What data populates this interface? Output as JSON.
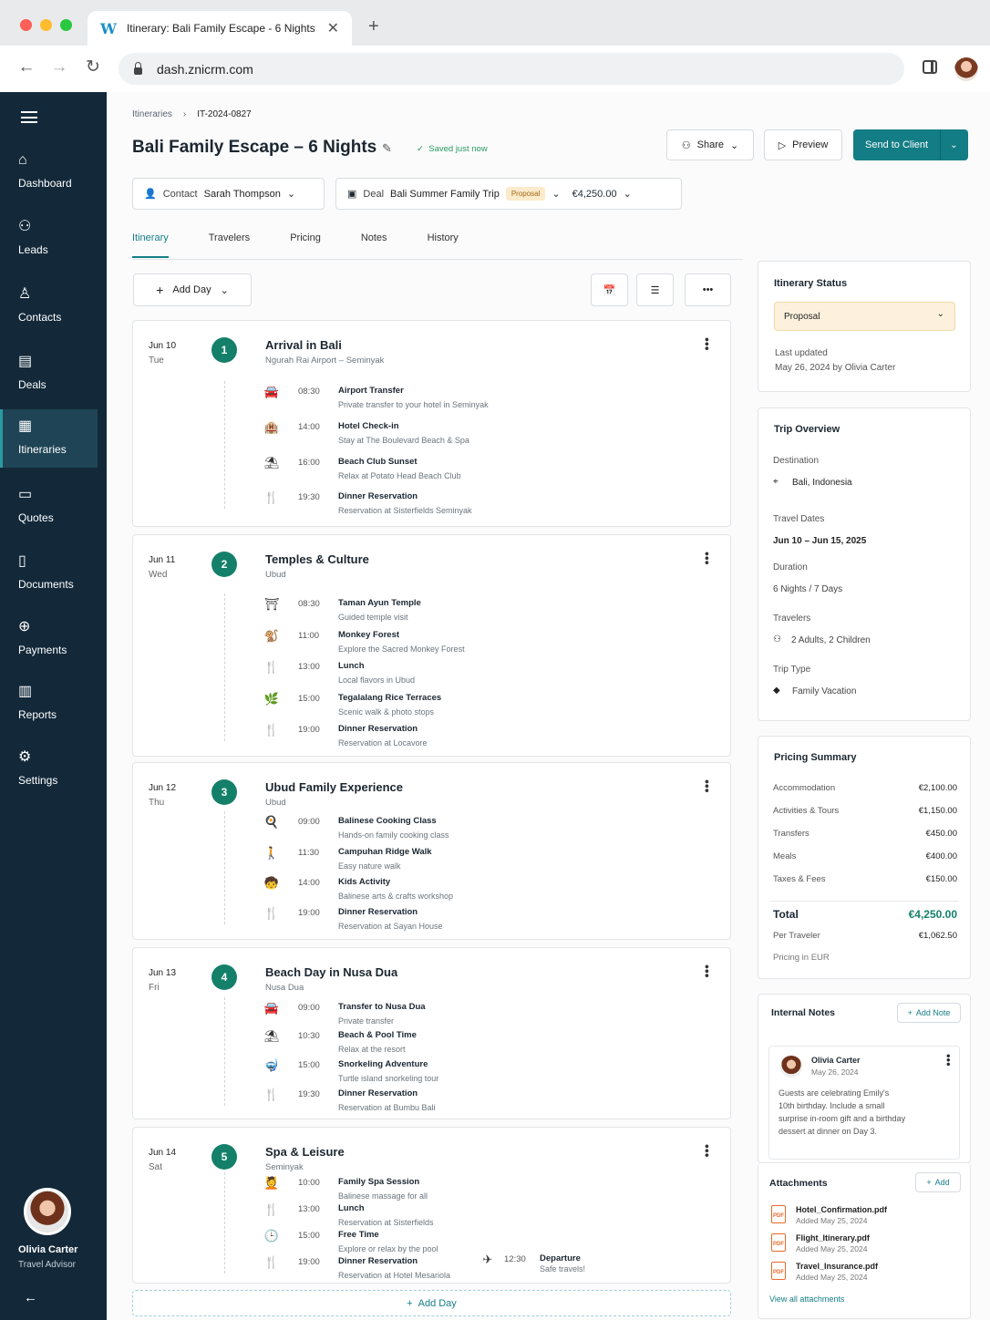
{
  "browser": {
    "tab_title": "Itinerary: Bali Family Escape - 6 Nights",
    "url": "dash.znicrm.com",
    "tab_logo": "W"
  },
  "sidebar": {
    "items": [
      {
        "label": "Dashboard",
        "icon": "home-icon"
      },
      {
        "label": "Leads",
        "icon": "users-icon"
      },
      {
        "label": "Contacts",
        "icon": "user-plus-icon"
      },
      {
        "label": "Deals",
        "icon": "briefcase-icon"
      },
      {
        "label": "Itineraries",
        "icon": "calendar-icon",
        "active": true
      },
      {
        "label": "Quotes",
        "icon": "file-icon"
      },
      {
        "label": "Documents",
        "icon": "document-icon"
      },
      {
        "label": "Payments",
        "icon": "dollar-icon"
      },
      {
        "label": "Reports",
        "icon": "bar-chart-icon"
      },
      {
        "label": "Settings",
        "icon": "gear-icon"
      }
    ],
    "profile": {
      "name": "Olivia Carter",
      "role": "Travel Advisor"
    }
  },
  "header": {
    "breadcrumb": [
      "Itineraries",
      "IT-2024-0827"
    ],
    "title": "Bali Family Escape – 6 Nights",
    "saved": "Saved just now",
    "share": "Share",
    "preview": "Preview",
    "send": "Send to Client"
  },
  "meta": {
    "contact_label": "Contact",
    "contact_value": "Sarah Thompson",
    "deal_label": "Deal",
    "deal_value": "Bali Summer Family Trip",
    "deal_badge": "Proposal",
    "deal_amount": "€4,250.00"
  },
  "tabs": [
    "Itinerary",
    "Travelers",
    "Pricing",
    "Notes",
    "History"
  ],
  "toolbar": {
    "add_day": "Add Day"
  },
  "days": [
    {
      "date": "Jun 10",
      "dow": "Tue",
      "num": "1",
      "title": "Arrival in Bali",
      "sub": "Ngurah Rai Airport – Seminyak",
      "acts": [
        {
          "icon": "🚘",
          "time": "08:30",
          "name": "Airport Transfer",
          "desc": "Private transfer to your hotel in Seminyak"
        },
        {
          "icon": "🏨",
          "time": "14:00",
          "name": "Hotel Check-in",
          "desc": "Stay at The Boulevard Beach & Spa"
        },
        {
          "icon": "⛱",
          "time": "16:00",
          "name": "Beach Club Sunset",
          "desc": "Relax at Potato Head Beach Club"
        },
        {
          "icon": "🍴",
          "time": "19:30",
          "name": "Dinner Reservation",
          "desc": "Reservation at Sisterfields Seminyak"
        }
      ]
    },
    {
      "date": "Jun 11",
      "dow": "Wed",
      "num": "2",
      "title": "Temples & Culture",
      "sub": "Ubud",
      "acts": [
        {
          "icon": "⛩",
          "time": "08:30",
          "name": "Taman Ayun Temple",
          "desc": "Guided temple visit"
        },
        {
          "icon": "🐒",
          "time": "11:00",
          "name": "Monkey Forest",
          "desc": "Explore the Sacred Monkey Forest"
        },
        {
          "icon": "🍴",
          "time": "13:00",
          "name": "Lunch",
          "desc": "Local flavors in Ubud"
        },
        {
          "icon": "🌿",
          "time": "15:00",
          "name": "Tegalalang Rice Terraces",
          "desc": "Scenic walk & photo stops"
        },
        {
          "icon": "🍴",
          "time": "19:00",
          "name": "Dinner Reservation",
          "desc": "Reservation at Locavore"
        }
      ]
    },
    {
      "date": "Jun 12",
      "dow": "Thu",
      "num": "3",
      "title": "Ubud Family Experience",
      "sub": "Ubud",
      "acts": [
        {
          "icon": "🍳",
          "time": "09:00",
          "name": "Balinese Cooking Class",
          "desc": "Hands-on family cooking class"
        },
        {
          "icon": "🚶",
          "time": "11:30",
          "name": "Campuhan Ridge Walk",
          "desc": "Easy nature walk"
        },
        {
          "icon": "🧒",
          "time": "14:00",
          "name": "Kids Activity",
          "desc": "Balinese arts & crafts workshop"
        },
        {
          "icon": "🍴",
          "time": "19:00",
          "name": "Dinner Reservation",
          "desc": "Reservation at Sayan House"
        }
      ]
    },
    {
      "date": "Jun 13",
      "dow": "Fri",
      "num": "4",
      "title": "Beach Day in Nusa Dua",
      "sub": "Nusa Dua",
      "acts": [
        {
          "icon": "🚘",
          "time": "09:00",
          "name": "Transfer to Nusa Dua",
          "desc": "Private transfer"
        },
        {
          "icon": "⛱",
          "time": "10:30",
          "name": "Beach & Pool Time",
          "desc": "Relax at the resort"
        },
        {
          "icon": "🤿",
          "time": "15:00",
          "name": "Snorkeling Adventure",
          "desc": "Turtle island snorkeling tour"
        },
        {
          "icon": "🍴",
          "time": "19:30",
          "name": "Dinner Reservation",
          "desc": "Reservation at Bumbu Bali"
        }
      ]
    },
    {
      "date": "Jun 14",
      "dow": "Sat",
      "num": "5",
      "title": "Spa & Leisure",
      "sub": "Seminyak",
      "acts": [
        {
          "icon": "💆",
          "time": "10:00",
          "name": "Family Spa Session",
          "desc": "Balinese massage for all"
        },
        {
          "icon": "🍴",
          "time": "13:00",
          "name": "Lunch",
          "desc": "Reservation at Sisterfields"
        },
        {
          "icon": "🕒",
          "time": "15:00",
          "name": "Free Time",
          "desc": "Explore or relax by the pool"
        },
        {
          "icon": "🍴",
          "time": "19:00",
          "name": "Dinner Reservation",
          "desc": "Reservation at Hotel Mesariola"
        }
      ],
      "extra": {
        "icon": "✈",
        "time": "12:30",
        "name": "Departure",
        "desc": "Safe travels!"
      }
    }
  ],
  "add_day_bottom": "Add Day",
  "status": {
    "title": "Itinerary Status",
    "value": "Proposal",
    "updated_label": "Last updated",
    "updated_value": "May 26, 2024 by Olivia Carter"
  },
  "overview": {
    "title": "Trip Overview",
    "dest_label": "Destination",
    "dest": "Bali, Indonesia",
    "dates_label": "Travel Dates",
    "dates": "Jun 10 – Jun 15, 2025",
    "dur_label": "Duration",
    "dur": "6 Nights / 7 Days",
    "trav_label": "Travelers",
    "trav": "2 Adults, 2 Children",
    "type_label": "Trip Type",
    "type": "Family Vacation"
  },
  "pricing": {
    "title": "Pricing Summary",
    "rows": [
      {
        "k": "Accommodation",
        "v": "€2,100.00"
      },
      {
        "k": "Activities & Tours",
        "v": "€1,150.00"
      },
      {
        "k": "Transfers",
        "v": "€450.00"
      },
      {
        "k": "Meals",
        "v": "€400.00"
      },
      {
        "k": "Taxes & Fees",
        "v": "€150.00"
      }
    ],
    "total_label": "Total",
    "total": "€4,250.00",
    "per_label": "Per Traveler",
    "per": "€1,062.50",
    "currency_note": "Pricing in EUR"
  },
  "notes": {
    "title": "Internal Notes",
    "add": "Add Note",
    "author": "Olivia Carter",
    "date": "May 26, 2024",
    "text": "Guests are celebrating Emily's 10th birthday. Include a small surprise in-room gift and a birthday dessert at dinner on Day 3."
  },
  "attachments": {
    "title": "Attachments",
    "add": "Add",
    "files": [
      {
        "name": "Hotel_Confirmation.pdf",
        "date": "Added May 25, 2024"
      },
      {
        "name": "Flight_Itinerary.pdf",
        "date": "Added May 25, 2024"
      },
      {
        "name": "Travel_Insurance.pdf",
        "date": "Added May 25, 2024"
      }
    ],
    "view_all": "View all attachments"
  },
  "colors": {
    "accent": "#137d85",
    "sidebar": "#13293a",
    "success": "#14806a",
    "proposal_bg": "#fdf1dd"
  }
}
